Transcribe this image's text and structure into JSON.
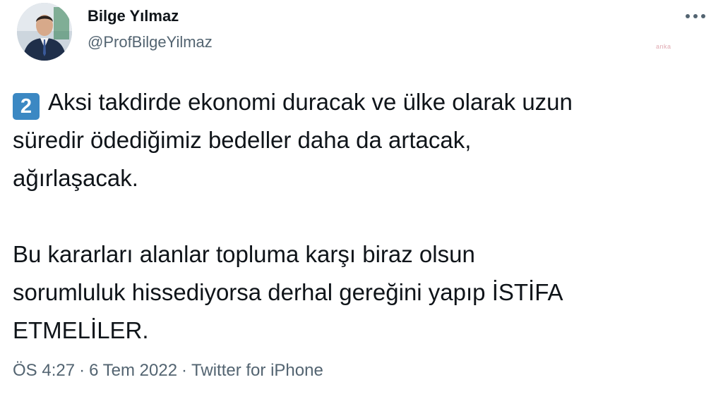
{
  "tweet": {
    "author": {
      "name": "Bilge Yılmaz",
      "handle": "@ProfBilgeYilmaz"
    },
    "watermark": "anka",
    "keycap_emoji": "2",
    "paragraphs": [
      [
        "Aksi takdirde ekonomi duracak ve ülke olarak uzun",
        "süredir ödediğimiz bedeller daha da artacak,",
        "ağırlaşacak."
      ],
      [
        "Bu kararları alanlar topluma karşı biraz olsun",
        "sorumluluk hissediyorsa derhal gereğini yapıp İSTİFA",
        "ETMELİLER."
      ]
    ],
    "meta": {
      "time": "ÖS 4:27",
      "separator": "·",
      "date": "6 Tem 2022",
      "source": "Twitter for iPhone"
    }
  },
  "colors": {
    "text": "#0f1419",
    "secondary_text": "#536471",
    "keycap_blue": "#3b88c3",
    "background": "#ffffff"
  },
  "icons": {
    "more": "more-horizontal-icon",
    "keycap": "keycap-digit-two-emoji"
  }
}
